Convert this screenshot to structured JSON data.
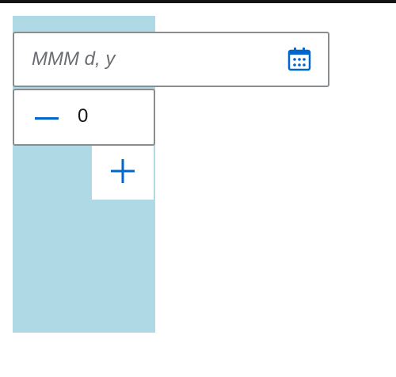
{
  "date_picker": {
    "placeholder": "MMM d, y",
    "value": "",
    "calendar_icon": "calendar-icon"
  },
  "stepper": {
    "value": "0",
    "decrement_icon": "minus-icon",
    "increment_icon": "plus-icon"
  },
  "colors": {
    "accent": "#0066cc",
    "panel_background": "#b0d9e6",
    "border": "#8a8d90",
    "top_bar": "#151515"
  }
}
